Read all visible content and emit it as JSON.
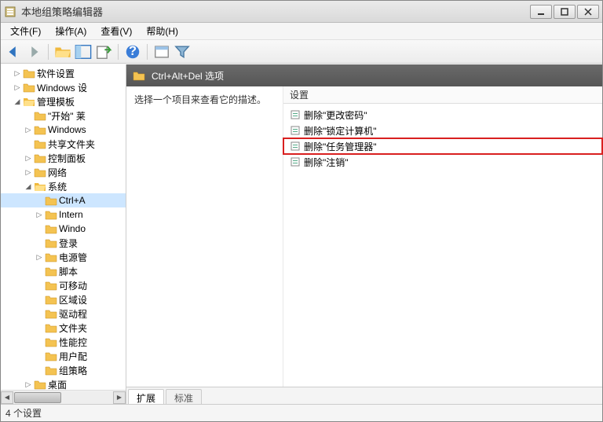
{
  "window": {
    "title": "本地组策略编辑器"
  },
  "menu": {
    "file": "文件(F)",
    "action": "操作(A)",
    "view": "查看(V)",
    "help": "帮助(H)"
  },
  "tree": {
    "n0": "软件设置",
    "n1": "Windows 设",
    "n2": "管理模板",
    "n3": "\"开始\" 莱",
    "n4": "Windows",
    "n5": "共享文件夹",
    "n6": "控制面板",
    "n7": "网络",
    "n8": "系统",
    "n9": "Ctrl+A",
    "n10": "Intern",
    "n11": "Windo",
    "n12": "登录",
    "n13": "电源管",
    "n14": "脚本",
    "n15": "可移动",
    "n16": "区域设",
    "n17": "驱动程",
    "n18": "文件夹",
    "n19": "性能控",
    "n20": "用户配",
    "n21": "组策略",
    "n22": "桌面"
  },
  "right": {
    "header": "Ctrl+Alt+Del 选项",
    "desc": "选择一个项目来查看它的描述。",
    "settings_header": "设置",
    "items": {
      "i0": "删除\"更改密码\"",
      "i1": "删除\"锁定计算机\"",
      "i2": "删除\"任务管理器\"",
      "i3": "删除\"注销\""
    },
    "tab_ext": "扩展",
    "tab_std": "标准"
  },
  "status": "4 个设置"
}
